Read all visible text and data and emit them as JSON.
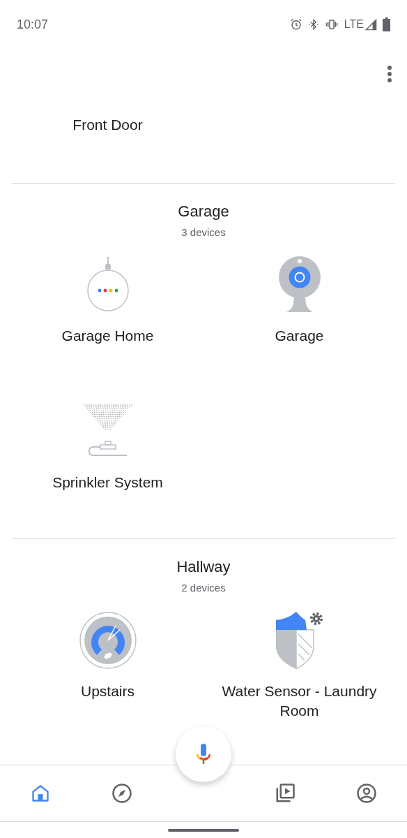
{
  "status_bar": {
    "time": "10:07",
    "network": "LTE"
  },
  "rooms": [
    {
      "devices": [
        {
          "name": "Front Door"
        }
      ]
    },
    {
      "title": "Garage",
      "count": "3 devices",
      "devices": [
        {
          "kind": "speaker",
          "name": "Garage Home"
        },
        {
          "kind": "camera",
          "name": "Garage"
        },
        {
          "kind": "sprinkler",
          "name": "Sprinkler System"
        }
      ]
    },
    {
      "title": "Hallway",
      "count": "2 devices",
      "devices": [
        {
          "kind": "thermostat",
          "name": "Upstairs"
        },
        {
          "kind": "shield",
          "name": "Water Sensor - Laundry Room"
        }
      ]
    }
  ],
  "nav": [
    {
      "kind": "home",
      "selected": true
    },
    {
      "kind": "explore",
      "selected": false
    },
    {
      "kind": "media",
      "selected": false
    },
    {
      "kind": "account",
      "selected": false
    }
  ]
}
